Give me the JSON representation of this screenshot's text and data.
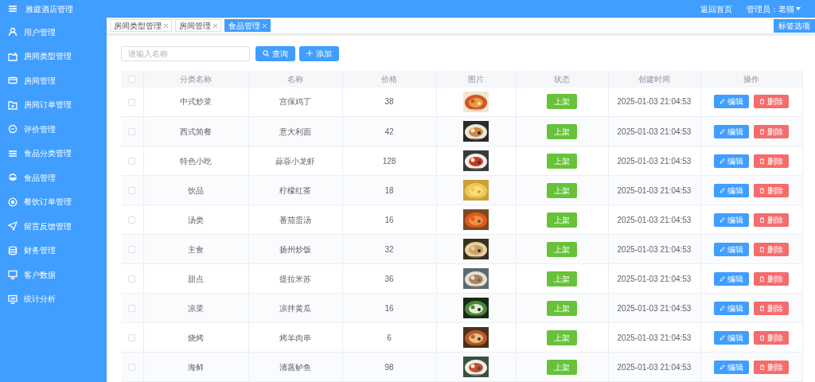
{
  "app": {
    "title": "雅庭酒店管理",
    "links": [
      "返回首页",
      "管理员：老猫"
    ]
  },
  "sidebar": {
    "items": [
      {
        "label": "用户管理"
      },
      {
        "label": "房间类型管理"
      },
      {
        "label": "房间管理"
      },
      {
        "label": "房间订单管理"
      },
      {
        "label": "评价管理"
      },
      {
        "label": "食品分类管理"
      },
      {
        "label": "食品管理"
      },
      {
        "label": "餐饮订单管理"
      },
      {
        "label": "留言反馈管理"
      },
      {
        "label": "财务管理"
      },
      {
        "label": "客户数据"
      },
      {
        "label": "统计分析"
      }
    ]
  },
  "tabs": [
    {
      "label": "房间类型管理",
      "selected": false
    },
    {
      "label": "房间管理",
      "selected": false
    },
    {
      "label": "食品管理",
      "selected": true
    }
  ],
  "tab_options": "标签选项",
  "search": {
    "placeholder": "请输入名称"
  },
  "buttons": {
    "query": "查询",
    "add": "添加"
  },
  "table": {
    "columns": [
      "分类名称",
      "名称",
      "价格",
      "图片",
      "状态",
      "创建时间",
      "操作"
    ],
    "header_checked": false,
    "rows": [
      {
        "checked": false,
        "category": "中式炒菜",
        "name": "宫保鸡丁",
        "price": "38",
        "status": "上架",
        "created": "2025-01-03 21:04:53",
        "edit": "编辑",
        "delete": "删除"
      },
      {
        "checked": false,
        "category": "西式简餐",
        "name": "意大利面",
        "price": "42",
        "status": "上架",
        "created": "2025-01-03 21:04:53",
        "edit": "编辑",
        "delete": "删除"
      },
      {
        "checked": false,
        "category": "特色小吃",
        "name": "蒜蓉小龙虾",
        "price": "128",
        "status": "上架",
        "created": "2025-01-03 21:04:53",
        "edit": "编辑",
        "delete": "删除"
      },
      {
        "checked": false,
        "category": "饮品",
        "name": "柠檬红茶",
        "price": "18",
        "status": "上架",
        "created": "2025-01-03 21:04:53",
        "edit": "编辑",
        "delete": "删除"
      },
      {
        "checked": false,
        "category": "汤类",
        "name": "番茄蛋汤",
        "price": "16",
        "status": "上架",
        "created": "2025-01-03 21:04:53",
        "edit": "编辑",
        "delete": "删除"
      },
      {
        "checked": false,
        "category": "主食",
        "name": "扬州炒饭",
        "price": "32",
        "status": "上架",
        "created": "2025-01-03 21:04:53",
        "edit": "编辑",
        "delete": "删除"
      },
      {
        "checked": false,
        "category": "甜点",
        "name": "提拉米苏",
        "price": "36",
        "status": "上架",
        "created": "2025-01-03 21:04:53",
        "edit": "编辑",
        "delete": "删除"
      },
      {
        "checked": false,
        "category": "凉菜",
        "name": "凉拌黄瓜",
        "price": "16",
        "status": "上架",
        "created": "2025-01-03 21:04:53",
        "edit": "编辑",
        "delete": "删除"
      },
      {
        "checked": false,
        "category": "烧烤",
        "name": "烤羊肉串",
        "price": "6",
        "status": "上架",
        "created": "2025-01-03 21:04:53",
        "edit": "编辑",
        "delete": "删除"
      },
      {
        "checked": false,
        "category": "海鲜",
        "name": "清蒸鲈鱼",
        "price": "98",
        "status": "上架",
        "created": "2025-01-03 21:04:53",
        "edit": "编辑",
        "delete": "删除"
      }
    ]
  }
}
